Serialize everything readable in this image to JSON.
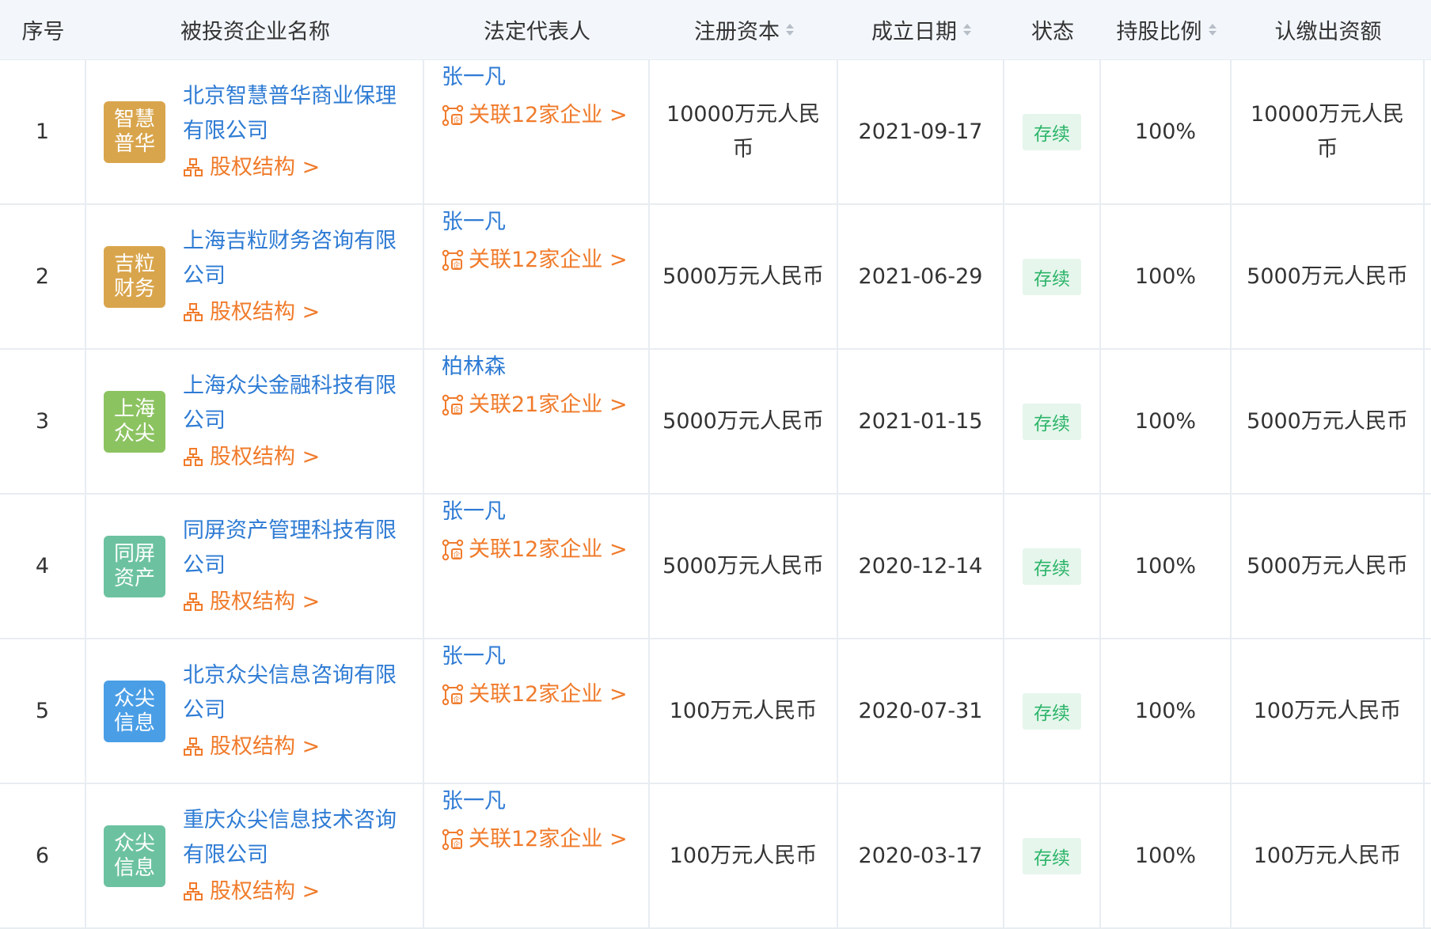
{
  "headers": {
    "index": "序号",
    "company": "被投资企业名称",
    "legal_rep": "法定代表人",
    "capital": "注册资本",
    "date": "成立日期",
    "status": "状态",
    "ratio": "持股比例",
    "subscribed": "认缴出资额"
  },
  "equity_label": "股权结构 >",
  "rows": [
    {
      "index": "1",
      "logo_text": "智慧\n普华",
      "logo_color": "#d9a54c",
      "company": "北京智慧普华商业保理有限公司",
      "legal_rep": "张一凡",
      "assoc": "关联12家企业 >",
      "capital": "10000万元人民币",
      "date": "2021-09-17",
      "status": "存续",
      "ratio": "100%",
      "subscribed": "10000万元人民币"
    },
    {
      "index": "2",
      "logo_text": "吉粒\n财务",
      "logo_color": "#d9a54c",
      "company": "上海吉粒财务咨询有限公司",
      "legal_rep": "张一凡",
      "assoc": "关联12家企业 >",
      "capital": "5000万元人民币",
      "date": "2021-06-29",
      "status": "存续",
      "ratio": "100%",
      "subscribed": "5000万元人民币"
    },
    {
      "index": "3",
      "logo_text": "上海\n众尖",
      "logo_color": "#8cc361",
      "company": "上海众尖金融科技有限公司",
      "legal_rep": "柏林森",
      "assoc": "关联21家企业 >",
      "capital": "5000万元人民币",
      "date": "2021-01-15",
      "status": "存续",
      "ratio": "100%",
      "subscribed": "5000万元人民币"
    },
    {
      "index": "4",
      "logo_text": "同屏\n资产",
      "logo_color": "#6cc2a0",
      "company": "同屏资产管理科技有限公司",
      "legal_rep": "张一凡",
      "assoc": "关联12家企业 >",
      "capital": "5000万元人民币",
      "date": "2020-12-14",
      "status": "存续",
      "ratio": "100%",
      "subscribed": "5000万元人民币"
    },
    {
      "index": "5",
      "logo_text": "众尖\n信息",
      "logo_color": "#4a9ee6",
      "company": "北京众尖信息咨询有限公司",
      "legal_rep": "张一凡",
      "assoc": "关联12家企业 >",
      "capital": "100万元人民币",
      "date": "2020-07-31",
      "status": "存续",
      "ratio": "100%",
      "subscribed": "100万元人民币"
    },
    {
      "index": "6",
      "logo_text": "众尖\n信息",
      "logo_color": "#6cc2a0",
      "company": "重庆众尖信息技术咨询有限公司",
      "legal_rep": "张一凡",
      "assoc": "关联12家企业 >",
      "capital": "100万元人民币",
      "date": "2020-03-17",
      "status": "存续",
      "ratio": "100%",
      "subscribed": "100万元人民币"
    }
  ]
}
